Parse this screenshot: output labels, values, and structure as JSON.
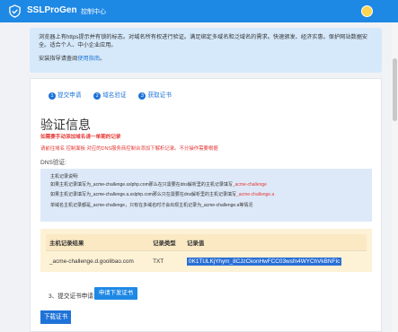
{
  "header": {
    "brand": "SSLProGen",
    "nav_label": "控制中心"
  },
  "notice": {
    "line1": "浏览器上有https提示并有锁的标志。对域名所有权进行验证。满足绑定多域名和泛域名的需求。快速颁发、经济实惠。保护网站数据安全。适合个人、中小企业应用。",
    "guide_prefix": "安装指导请查阅",
    "guide_link": "使用指南",
    "guide_suffix": "。"
  },
  "steps": [
    {
      "num": "1",
      "label": "提交申请"
    },
    {
      "num": "2",
      "label": "域名验证"
    },
    {
      "num": "3",
      "label": "获取证书"
    }
  ],
  "verify": {
    "title": "验证信息",
    "warning": "如需要手动添加域名请一单期的记录",
    "instruction": "请前往域名 控制面板 对应的DNS服务商控制台添加下解析记录。不分操作需要根据",
    "dns_label": "DNS验证:"
  },
  "dns_info": {
    "heading": "主机记录说明:",
    "line1_prefix": "如果主机记录填写为_acme-challenge.sslphp.com那么在只需要在dns解析里的主机记录填写",
    "line1_red": "_acme-challenge",
    "line2_prefix": "如果主机记录填写为_acme-challenge.a.sslphp.com那么只在需要在dns解析里的主机记录填写",
    "line2_red": "_acme-challenge.a",
    "line3": "单域名主机记录都是_acme-challenge，只有在多域名时才会出现主机记录为_acme-challenge.a等情况"
  },
  "record_table": {
    "headers": [
      "主机记录结果",
      "记录类型",
      "记录值"
    ],
    "rows": [
      {
        "host": "_acme-challenge.d.goolibao.com",
        "type": "TXT",
        "value": "0K1TULKjYhym_8CJzCkonHwFCC03wsfn4WYChVkBNFIc"
      }
    ]
  },
  "submit": {
    "step_label": "3、提交证书申请:",
    "apply_button": "申请下发证书"
  },
  "download_button": "下载证书"
}
